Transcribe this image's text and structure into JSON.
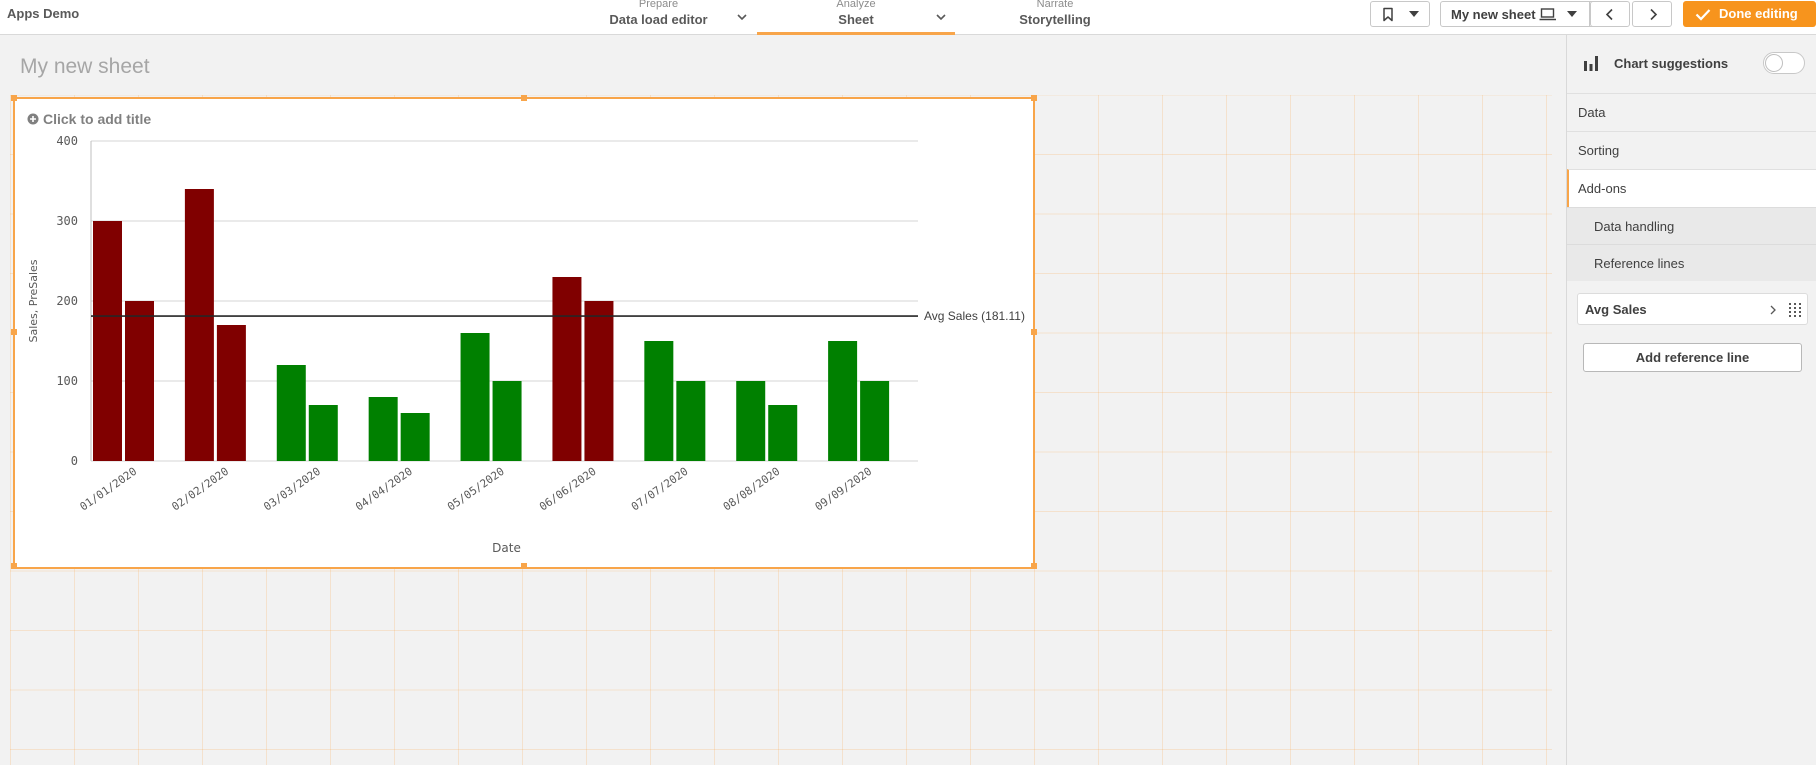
{
  "app": {
    "title": "Apps Demo"
  },
  "nav": {
    "tabs": [
      {
        "sub": "Prepare",
        "label": "Data load editor"
      },
      {
        "sub": "Analyze",
        "label": "Sheet"
      },
      {
        "sub": "Narrate",
        "label": "Storytelling"
      }
    ]
  },
  "toolbar": {
    "sheet_selector": "My new sheet",
    "done_label": "Done editing"
  },
  "sheet": {
    "title": "My new sheet"
  },
  "chart": {
    "add_title_label": "Click to add title",
    "reference_line_label": "Avg Sales (181.11)"
  },
  "chart_data": {
    "type": "bar",
    "categories": [
      "01/01/2020",
      "02/02/2020",
      "03/03/2020",
      "04/04/2020",
      "05/05/2020",
      "06/06/2020",
      "07/07/2020",
      "08/08/2020",
      "09/09/2020"
    ],
    "series": [
      {
        "values": [
          300,
          340,
          120,
          80,
          160,
          230,
          150,
          100,
          150
        ]
      },
      {
        "values": [
          200,
          170,
          70,
          60,
          100,
          200,
          100,
          70,
          100
        ]
      }
    ],
    "bar_colors": [
      "#800000",
      "#800000",
      "#008000",
      "#008000",
      "#008000",
      "#800000",
      "#008000",
      "#008000",
      "#008000"
    ],
    "xlabel": "Date",
    "ylabel": "Sales, PreSales",
    "ylim": [
      0,
      400
    ],
    "yticks": [
      0,
      100,
      200,
      300,
      400
    ],
    "reference_line": {
      "value": 181.11,
      "label": "Avg Sales (181.11)",
      "color": "#262626"
    },
    "grid": true
  },
  "panel": {
    "header": "Chart suggestions",
    "items": [
      {
        "label": "Data"
      },
      {
        "label": "Sorting"
      },
      {
        "label": "Add-ons"
      }
    ],
    "sections": [
      {
        "label": "Data handling"
      },
      {
        "label": "Reference lines"
      }
    ],
    "reference_line_item": "Avg Sales",
    "add_reference_line": "Add reference line"
  },
  "colors": {
    "accent": "#f7941d"
  }
}
